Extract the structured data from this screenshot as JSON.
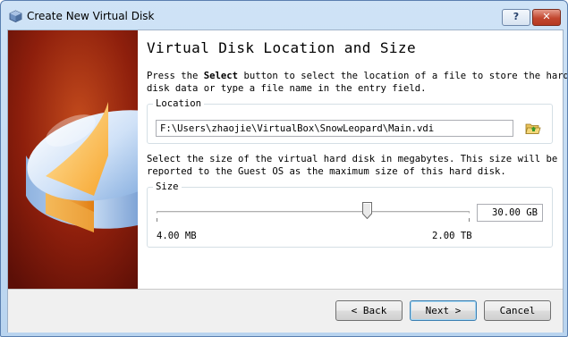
{
  "window": {
    "title": "Create New Virtual Disk",
    "help_label": "?",
    "close_label": "✕"
  },
  "page": {
    "heading": "Virtual Disk Location and Size",
    "location_desc_pre": "Press the ",
    "location_desc_bold": "Select",
    "location_desc_post": " button to select the location of a file to store the hard",
    "location_desc_line2": "disk data or type a file name in the entry field.",
    "location_group_label": "Location",
    "location_value": "F:\\Users\\zhaojie\\VirtualBox\\SnowLeopard\\Main.vdi",
    "size_desc_line1": "Select the size of the virtual hard disk in megabytes. This size will be",
    "size_desc_line2": "reported to the Guest OS as the maximum size of this hard disk.",
    "size_group_label": "Size",
    "size_value": "30.00 GB",
    "size_min_label": "4.00 MB",
    "size_max_label": "2.00 TB",
    "slider_position_fraction": 0.673
  },
  "footer": {
    "back_label": "< Back",
    "next_label": "Next >",
    "cancel_label": "Cancel"
  },
  "icons": {
    "app": "virtualbox-cube-icon",
    "folder": "folder-open-icon"
  }
}
